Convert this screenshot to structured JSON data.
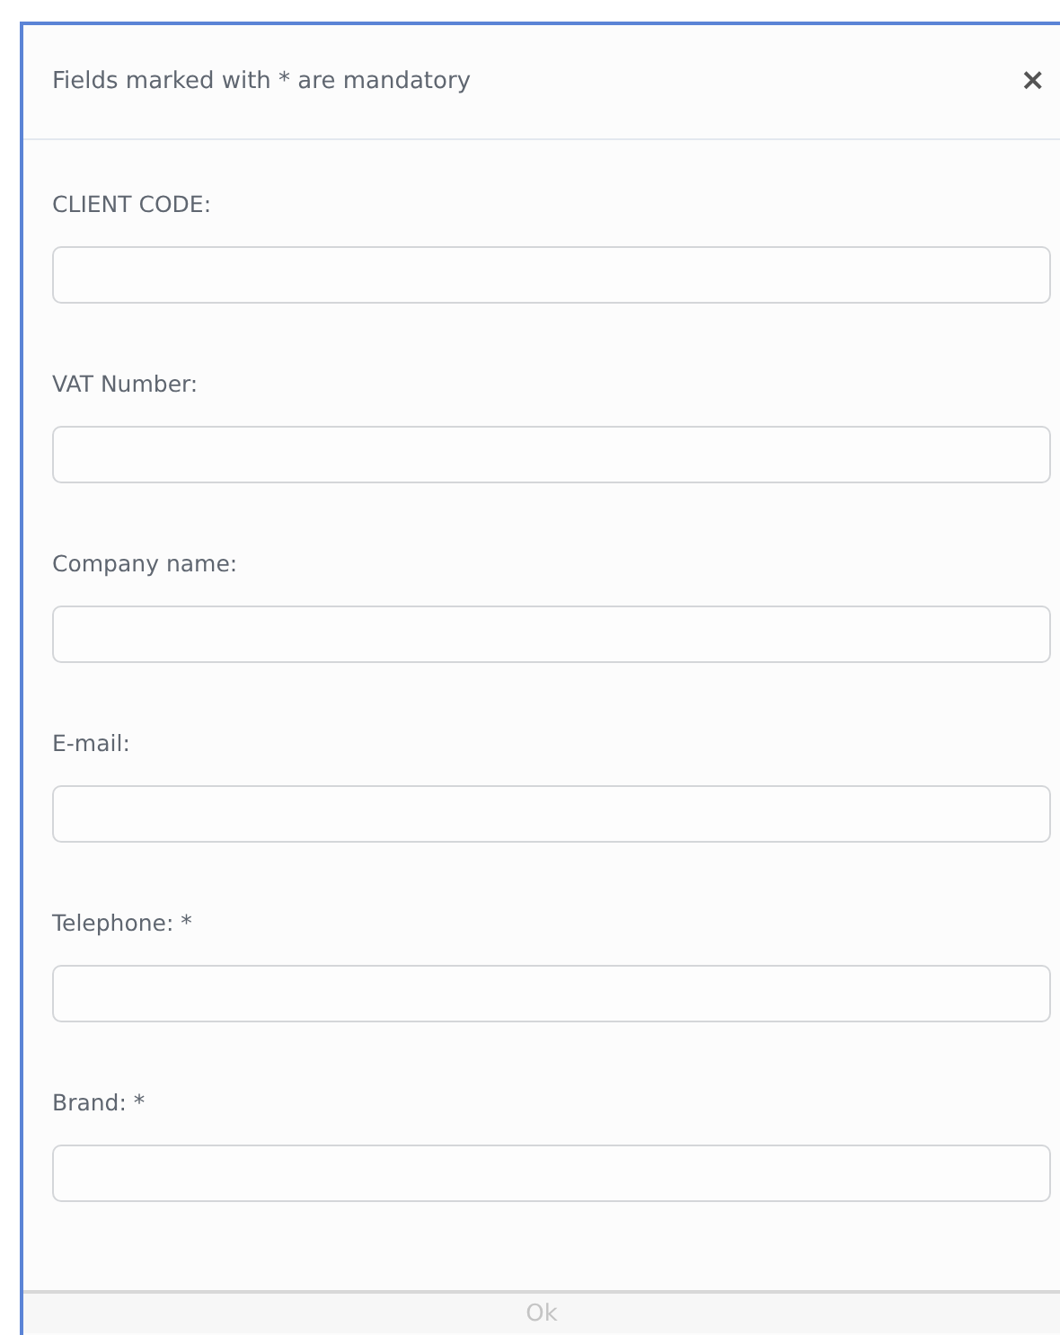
{
  "dialog": {
    "title": "Fields marked with * are mandatory",
    "close": "×"
  },
  "fields": [
    {
      "label": "CLIENT CODE:"
    },
    {
      "label": "VAT Number:"
    },
    {
      "label": "Company name:"
    },
    {
      "label": "E-mail:"
    },
    {
      "label": "Telephone: *"
    },
    {
      "label": "Brand: *"
    }
  ],
  "footer": {
    "button": {
      "label": "Ok",
      "disabled": true
    }
  }
}
